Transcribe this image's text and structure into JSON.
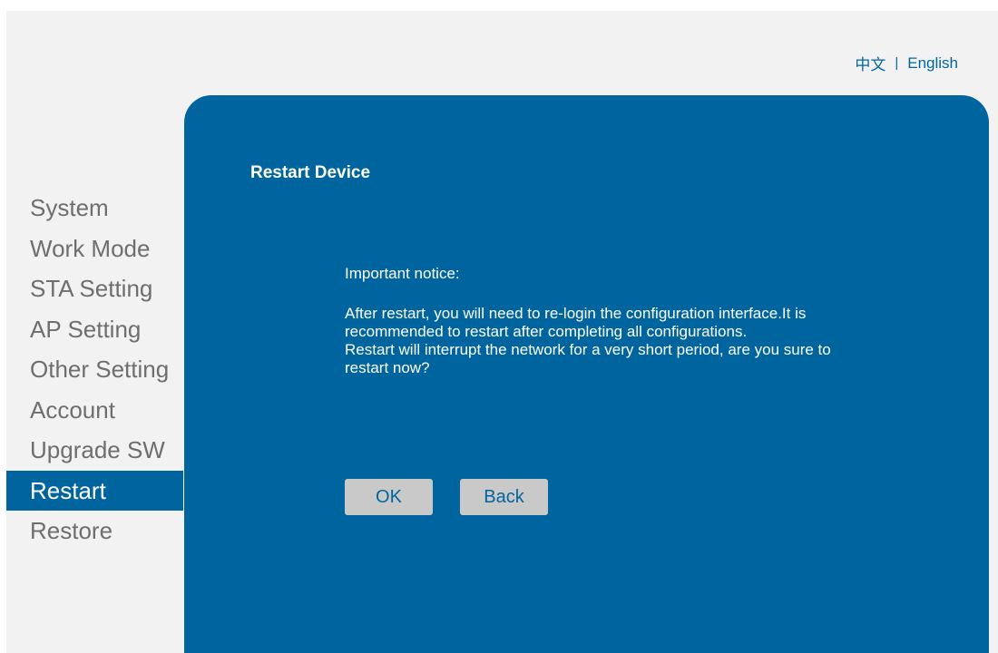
{
  "header": {
    "lang_chinese": "中文",
    "lang_separator": "|",
    "lang_english": "English"
  },
  "sidebar": {
    "items": [
      {
        "label": "System",
        "active": false
      },
      {
        "label": "Work Mode",
        "active": false
      },
      {
        "label": "STA Setting",
        "active": false
      },
      {
        "label": "AP Setting",
        "active": false
      },
      {
        "label": "Other Setting",
        "active": false
      },
      {
        "label": "Account",
        "active": false
      },
      {
        "label": "Upgrade SW",
        "active": false
      },
      {
        "label": "Restart",
        "active": true
      },
      {
        "label": "Restore",
        "active": false
      }
    ]
  },
  "main": {
    "title": "Restart Device",
    "notice_heading": "Important notice:",
    "notice_line1": "After restart, you will need to re-login the configuration interface.It is recommended to restart after completing all configurations.",
    "notice_line2": "Restart will interrupt the network for a very short period, are you sure to restart now?",
    "ok_label": "OK",
    "back_label": "Back"
  },
  "colors": {
    "brand": "#00659e",
    "background": "#f2f2f2",
    "button_bg": "#c9c9c9",
    "sidebar_text": "#6e6e6e"
  }
}
